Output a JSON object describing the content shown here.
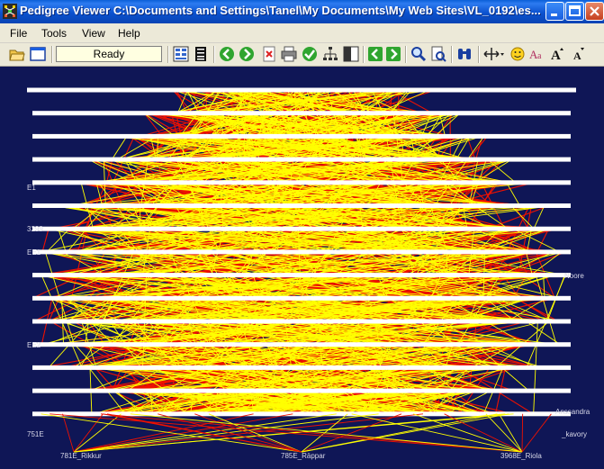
{
  "window": {
    "title": "Pedigree Viewer  C:\\Documents and Settings\\Tanel\\My Documents\\My Web Sites\\VL_0192\\es..."
  },
  "menu": {
    "items": [
      "File",
      "Tools",
      "View",
      "Help"
    ]
  },
  "toolbar": {
    "status": "Ready"
  },
  "pedigree": {
    "bottom_labels": [
      "781E_Rikkur",
      "785E_Räppar",
      "3968E_Riola"
    ],
    "partial_labels": [
      "3299",
      "EE1",
      "EE2",
      "E1",
      "751E",
      "_kavory",
      "Anssandra",
      "Noore"
    ],
    "line_colors": {
      "primary": "#ffff00",
      "secondary": "#ee1100",
      "rows": "#ffffff",
      "background": "#0f1656"
    }
  }
}
